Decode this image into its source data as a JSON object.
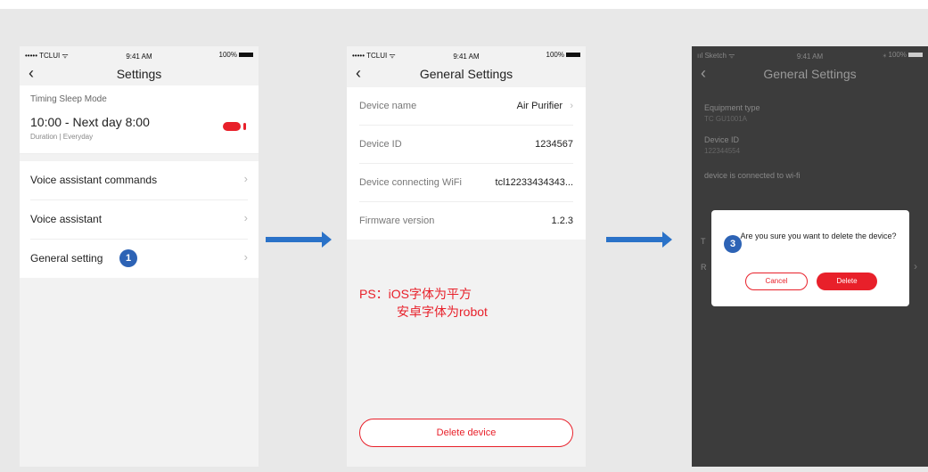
{
  "screen1": {
    "status": {
      "carrier": "••••• TCLUI ᯤ",
      "time": "9:41 AM",
      "battery": "100%"
    },
    "nav": {
      "back": "‹",
      "title": "Settings"
    },
    "section_label": "Timing Sleep Mode",
    "timing": {
      "main": "10:00 - Next day 8:00",
      "sub": "Duration | Everyday",
      "toggle_on": true
    },
    "items": [
      {
        "label": "Voice assistant commands"
      },
      {
        "label": "Voice assistant"
      },
      {
        "label": "General setting"
      }
    ],
    "badge": "1"
  },
  "screen2": {
    "status": {
      "carrier": "••••• TCLUI ᯤ",
      "time": "9:41 AM",
      "battery": "100%"
    },
    "nav": {
      "back": "‹",
      "title": "General Settings"
    },
    "rows": [
      {
        "label": "Device name",
        "value": "Air Purifier"
      },
      {
        "label": "Device ID",
        "value": "1234567"
      },
      {
        "label": "Device connecting WiFi",
        "value": "tcl12233434343..."
      },
      {
        "label": "Firmware version",
        "value": "1.2.3"
      }
    ],
    "note_line1": "PS：iOS字体为平方",
    "note_line2": "安卓字体为robot",
    "delete_button": "Delete device"
  },
  "screen3": {
    "status": {
      "carrier": "ııl Sketch ᯤ",
      "time": "9:41 AM",
      "battery": "⁎ 100%"
    },
    "nav": {
      "back": "‹",
      "title": "General Settings"
    },
    "rows": [
      {
        "label": "Equipment type",
        "value": "TC GU1001A"
      },
      {
        "label": "Device ID",
        "value": "122344554"
      }
    ],
    "wifi_label": "device is connected to wi-fi",
    "frag_t": "T",
    "frag_r": "R",
    "badge": "3",
    "dialog": {
      "message": "Are you sure you want to delete the device?",
      "cancel": "Cancel",
      "delete": "Delete"
    }
  },
  "chevron": "›",
  "colors": {
    "accent": "#e8202a",
    "badge": "#2d63b5",
    "arrow": "#2a72c8"
  }
}
